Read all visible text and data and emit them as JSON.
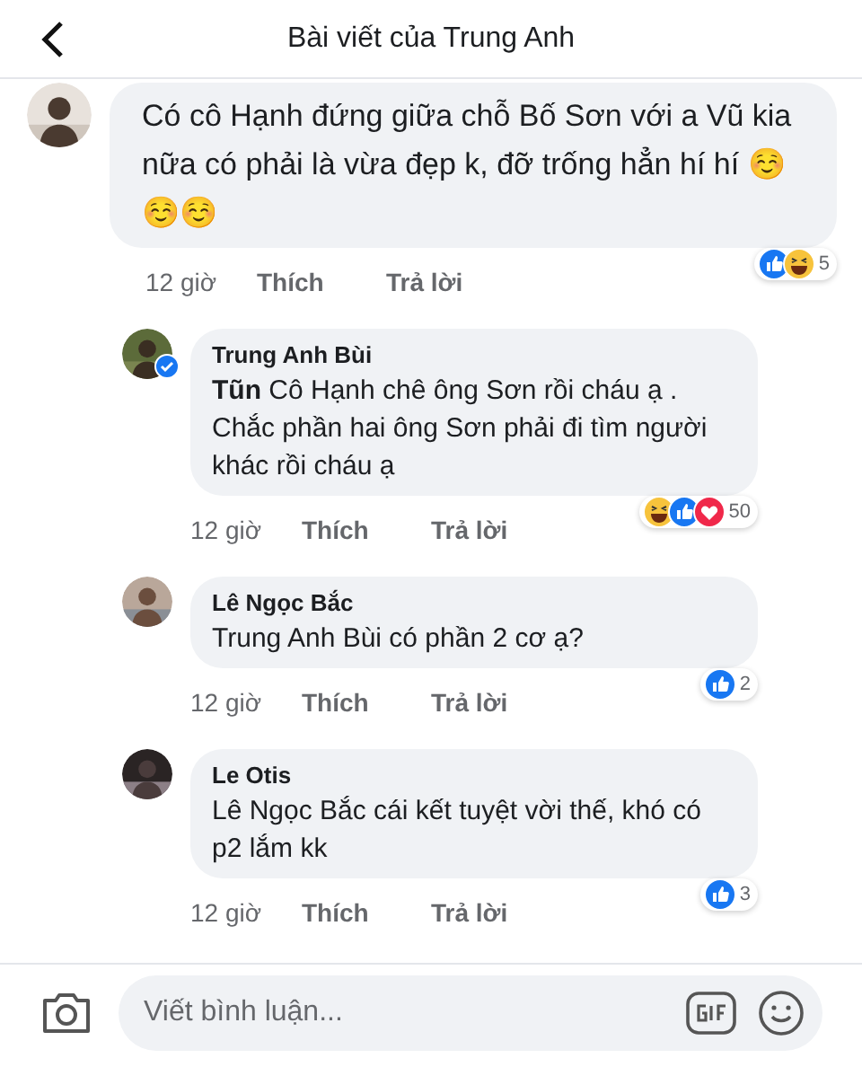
{
  "header": {
    "title": "Bài viết của Trung Anh"
  },
  "comments": [
    {
      "kind": "top",
      "text": "Có cô Hạnh đứng giữa chỗ Bố Sơn với a Vũ kia nữa có phải là vừa đẹp k, đỡ trống hẳn hí hí ☺️☺️☺️",
      "time": "12 giờ",
      "like": "Thích",
      "reply": "Trả lời",
      "reactions": [
        {
          "kind": "like"
        },
        {
          "kind": "haha"
        }
      ],
      "count": "5"
    },
    {
      "kind": "reply",
      "author": "Trung Anh Bùi",
      "verified": true,
      "text": "**Tũn** Cô Hạnh chê ông Sơn rồi cháu ạ . Chắc phần hai ông Sơn phải đi tìm người khác rồi cháu ạ",
      "time": "12 giờ",
      "like": "Thích",
      "reply": "Trả lời",
      "reactions": [
        {
          "kind": "haha"
        },
        {
          "kind": "like"
        },
        {
          "kind": "love"
        }
      ],
      "count": "50"
    },
    {
      "kind": "reply",
      "author": "Lê Ngọc Bắc",
      "verified": false,
      "text": "Trung Anh Bùi có phần 2 cơ ạ?",
      "time": "12 giờ",
      "like": "Thích",
      "reply": "Trả lời",
      "reactions": [
        {
          "kind": "like"
        }
      ],
      "count": "2"
    },
    {
      "kind": "reply",
      "author": "Le Otis",
      "verified": false,
      "text": "Lê Ngọc Bắc cái kết tuyệt vời thế, khó có p2 lắm kk",
      "time": "12 giờ",
      "like": "Thích",
      "reply": "Trả lời",
      "reactions": [
        {
          "kind": "like"
        }
      ],
      "count": "3"
    }
  ],
  "composer": {
    "placeholder": "Viết bình luận..."
  }
}
